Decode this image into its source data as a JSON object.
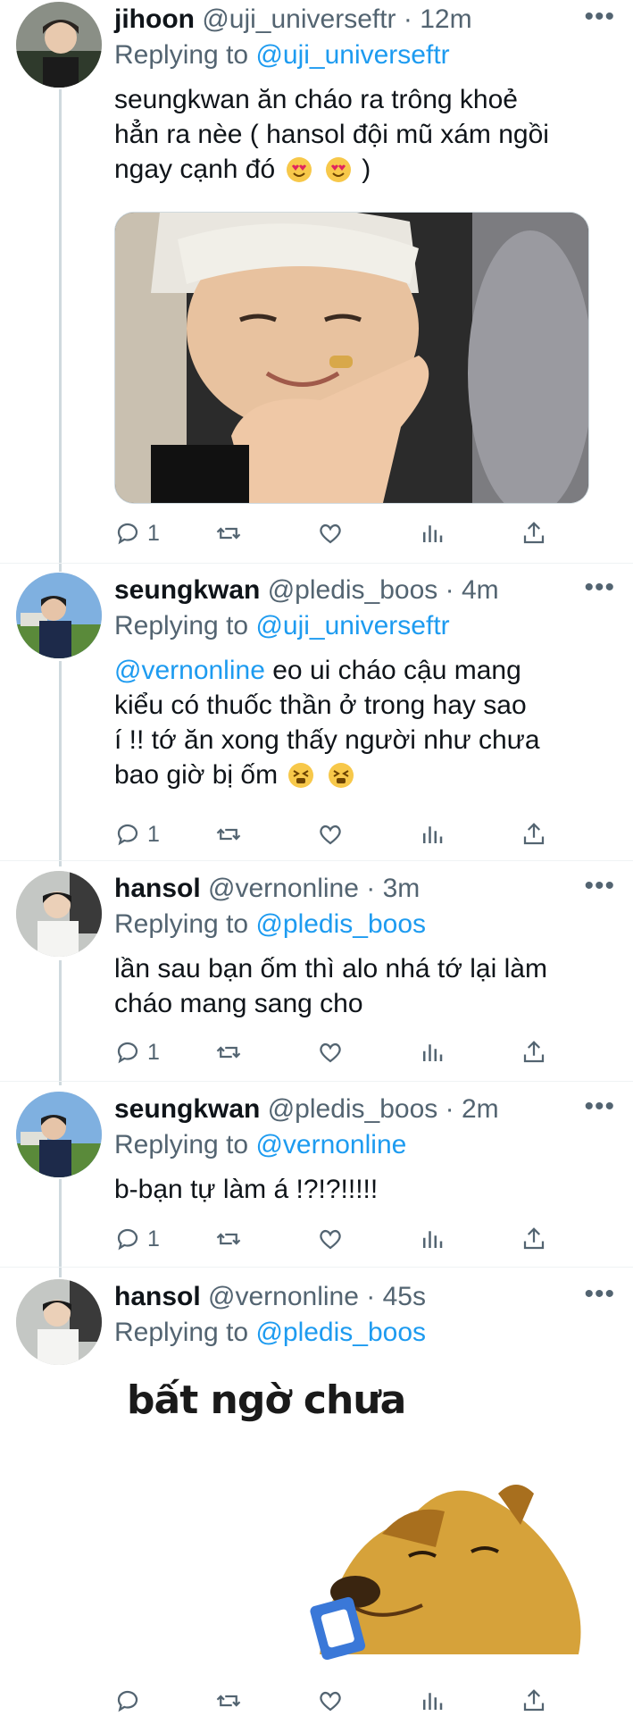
{
  "tweets": [
    {
      "name": "jihoon",
      "handle": "@uji_universeftr",
      "dot": "·",
      "time": "12m",
      "replying_prefix": "Replying to",
      "replying_to": "@uji_universeftr",
      "text_lines": [
        "seungkwan ăn cháo ra trông khoẻ",
        "hẳn ra nèe ( hansol đội mũ xám ngồi",
        "ngay cạnh đó"
      ],
      "text_tail": ")",
      "emoji": [
        "heart-eyes-emoji",
        "heart-eyes-emoji"
      ],
      "reply_count": "1",
      "has_photo": true
    },
    {
      "name": "seungkwan",
      "handle": "@pledis_boos",
      "dot": "·",
      "time": "4m",
      "replying_prefix": "Replying to",
      "replying_to": "@uji_universeftr",
      "mention": "@vernonline",
      "text_lines": [
        "eo ui cháo cậu mang",
        "kiểu có thuốc thần ở trong hay sao",
        "í !! tớ ăn xong thấy người như chưa",
        "bao giờ bị ốm"
      ],
      "emoji": [
        "tired-face-emoji",
        "tired-face-emoji"
      ],
      "reply_count": "1"
    },
    {
      "name": "hansol",
      "handle": "@vernonline",
      "dot": "·",
      "time": "3m",
      "replying_prefix": "Replying to",
      "replying_to": "@pledis_boos",
      "text_lines": [
        "lần sau bạn ốm thì alo nhá tớ lại làm",
        "cháo mang sang cho"
      ],
      "reply_count": "1"
    },
    {
      "name": "seungkwan",
      "handle": "@pledis_boos",
      "dot": "·",
      "time": "2m",
      "replying_prefix": "Replying to",
      "replying_to": "@vernonline",
      "text_lines": [
        "b-bạn tự làm á !?!?!!!!!"
      ],
      "reply_count": "1"
    },
    {
      "name": "hansol",
      "handle": "@vernonline",
      "dot": "·",
      "time": "45s",
      "replying_prefix": "Replying to",
      "replying_to": "@pledis_boos",
      "sticker_text": "bất ngờ chưa",
      "reply_count": ""
    }
  ],
  "more_label": "•••",
  "colors": {
    "link": "#1d9bf0",
    "secondary": "#536471",
    "thread": "#cfd9de"
  }
}
